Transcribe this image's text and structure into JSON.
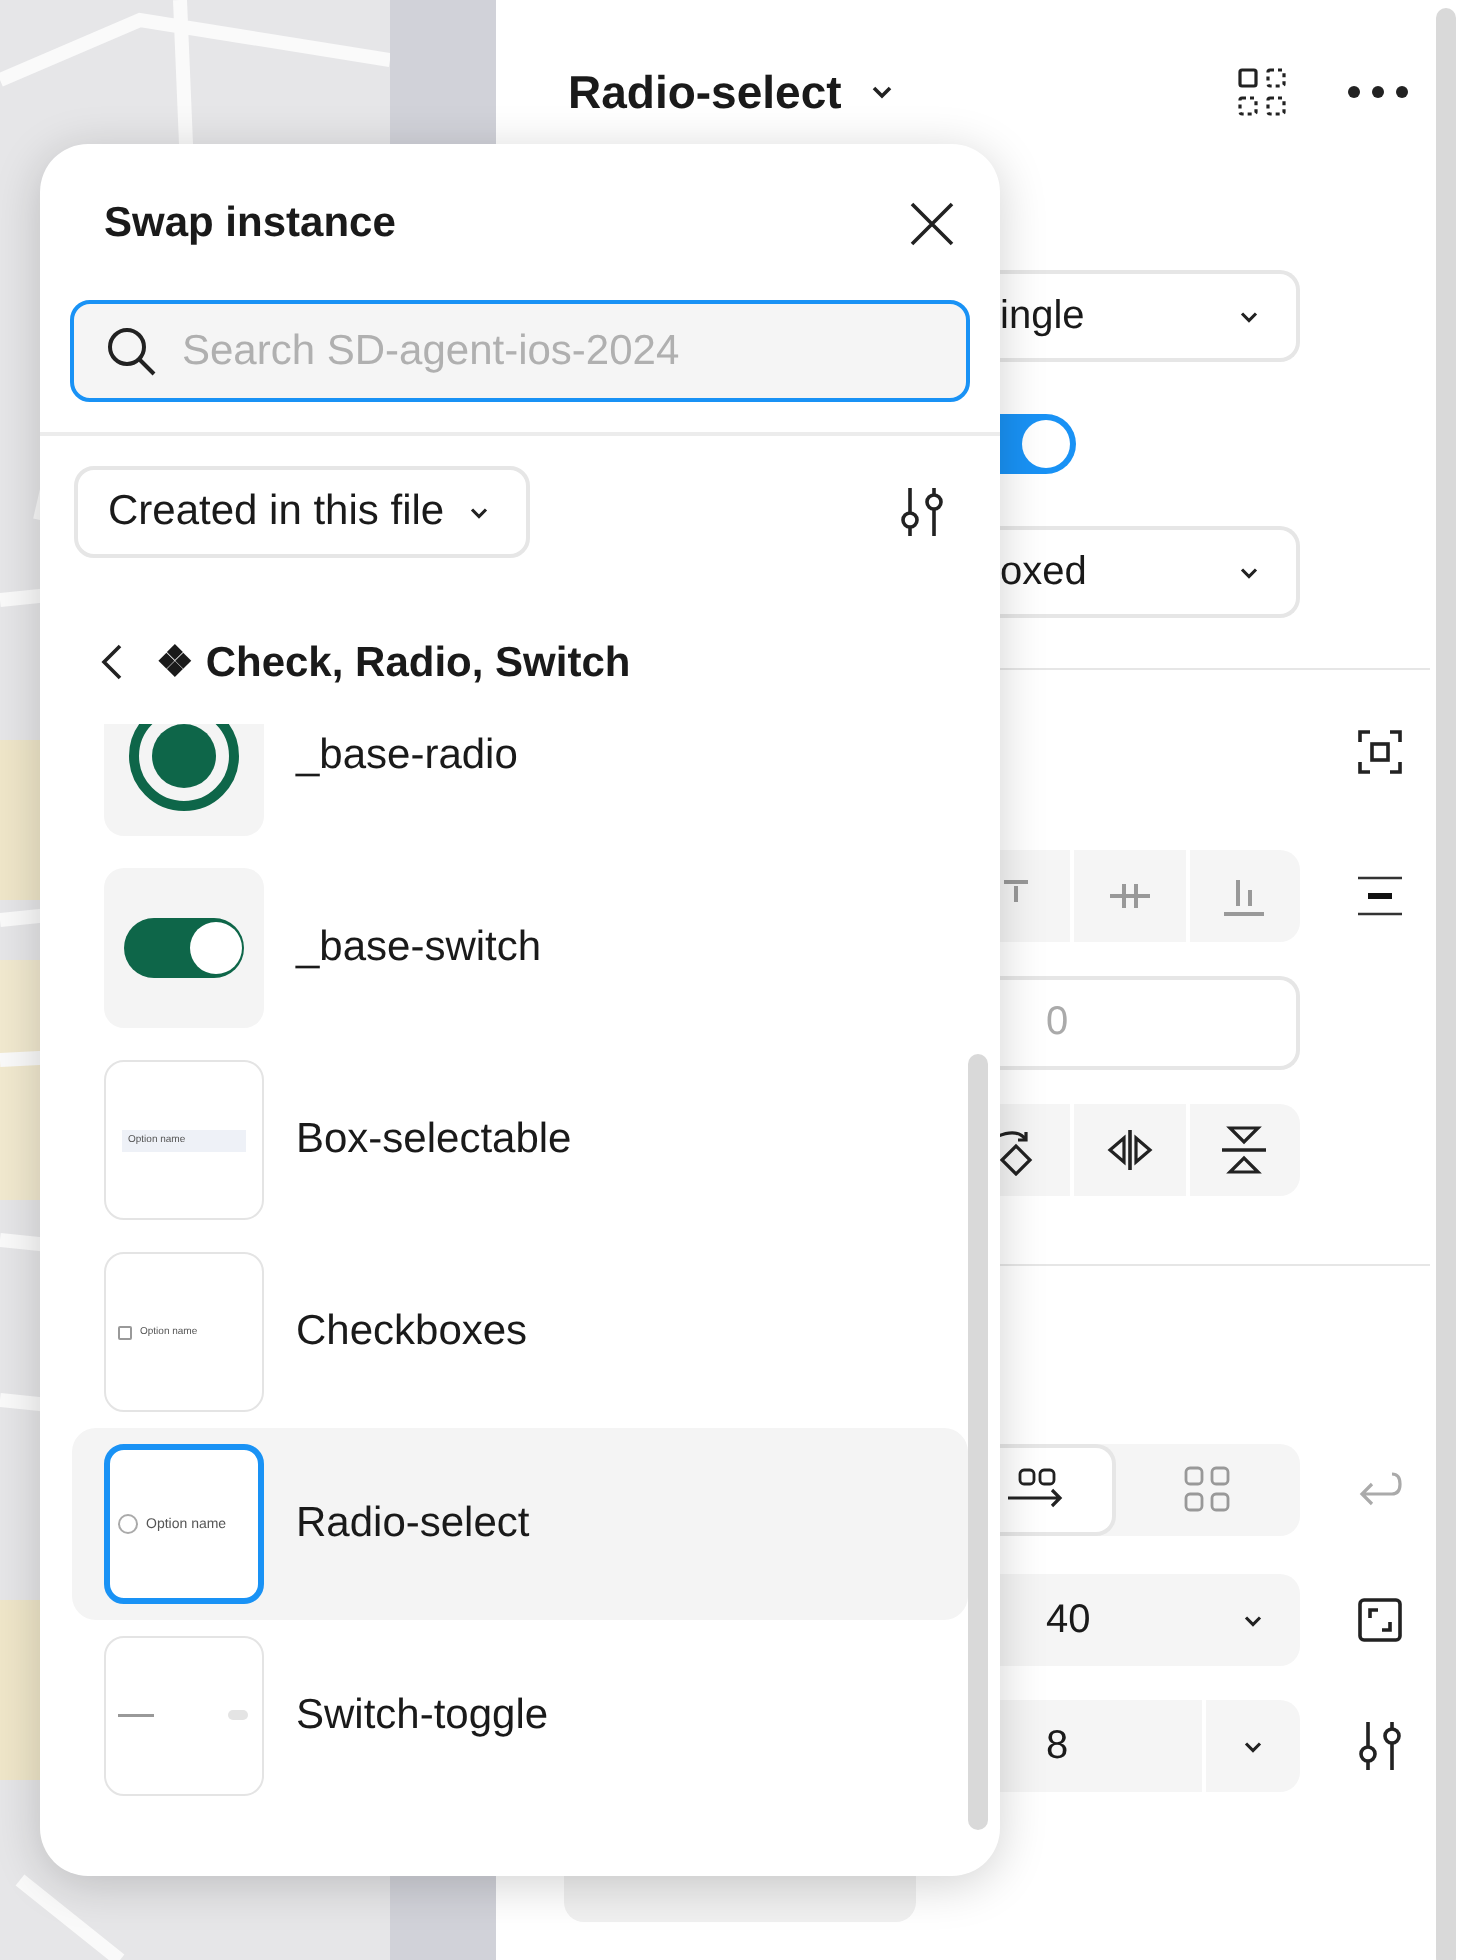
{
  "panel": {
    "title": "Radio-select",
    "variant_dropdown": {
      "value": "ingle"
    },
    "toggle": {
      "on": true
    },
    "style_dropdown": {
      "value": "oxed"
    },
    "y_field": {
      "value": "0"
    },
    "layout_options": [
      {
        "selected": true
      },
      {
        "selected": false
      }
    ],
    "height_field": {
      "value": "40"
    },
    "gap_field": {
      "value": "8"
    }
  },
  "popup": {
    "title": "Swap instance",
    "search": {
      "placeholder": "Search SD-agent-ios-2024"
    },
    "filter": {
      "value": "Created in this file"
    },
    "breadcrumb": "❖ Check, Radio, Switch",
    "items": [
      {
        "name": "_base-radio",
        "kind": "radio",
        "selected": false
      },
      {
        "name": "_base-switch",
        "kind": "switch",
        "selected": false
      },
      {
        "name": "Box-selectable",
        "kind": "box",
        "thumb_text": "Option name",
        "selected": false
      },
      {
        "name": "Checkboxes",
        "kind": "checkbox",
        "thumb_text": "Option name",
        "selected": false
      },
      {
        "name": "Radio-select",
        "kind": "radio-option",
        "thumb_text": "Option name",
        "selected": true
      },
      {
        "name": "Switch-toggle",
        "kind": "switch-row",
        "selected": false
      }
    ]
  }
}
